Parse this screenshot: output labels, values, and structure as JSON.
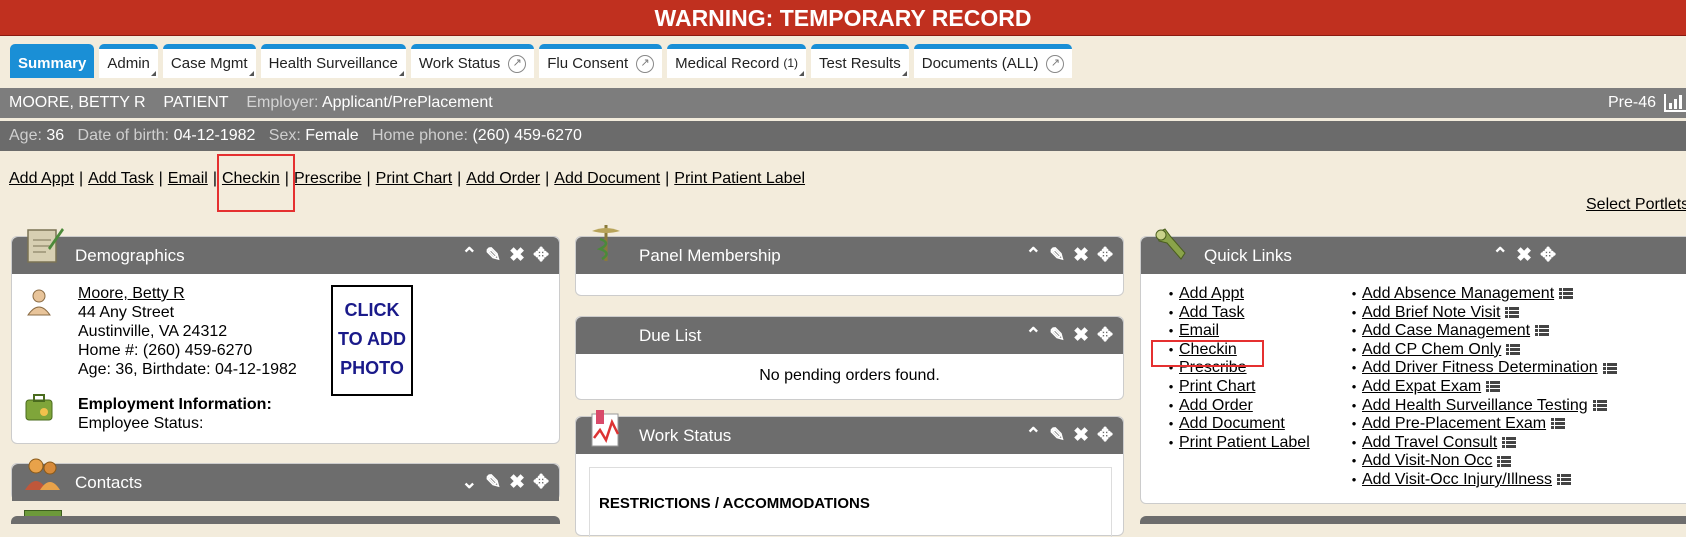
{
  "warning": "WARNING: TEMPORARY RECORD",
  "tabs": [
    {
      "label": "Summary",
      "icon": ""
    },
    {
      "label": "Admin",
      "icon": "corner"
    },
    {
      "label": "Case Mgmt",
      "icon": "corner"
    },
    {
      "label": "Health Surveillance",
      "icon": "corner"
    },
    {
      "label": "Work Status",
      "icon": "external-link-icon"
    },
    {
      "label": "Flu Consent",
      "icon": "external-link-icon"
    },
    {
      "label": "Medical Record",
      "count": "(1)",
      "icon": "corner"
    },
    {
      "label": "Test Results",
      "icon": "corner"
    },
    {
      "label": "Documents (ALL)",
      "icon": "external-link-icon"
    }
  ],
  "patient": {
    "name": "MOORE, BETTY R",
    "role": "PATIENT",
    "employer_label": "Employer:",
    "employer": "Applicant/PrePlacement",
    "code": "Pre-46",
    "age_label": "Age:",
    "age": "36",
    "dob_label": "Date of birth:",
    "dob": "04-12-1982",
    "sex_label": "Sex:",
    "sex": "Female",
    "phone_label": "Home phone:",
    "phone": "(260) 459-6270"
  },
  "actions": [
    "Add Appt",
    "Add Task",
    "Email",
    "Checkin",
    "Prescribe",
    "Print Chart",
    "Add Order",
    "Add Document",
    "Print Patient Label"
  ],
  "select_portlets": "Select Portlets",
  "demographics": {
    "title": "Demographics",
    "name_link": "Moore, Betty R",
    "street": "44 Any Street",
    "city": "Austinville, VA 24312",
    "home": "Home #: (260) 459-6270",
    "age_line": "Age: 36, Birthdate: 04-12-1982",
    "photo_l1": "CLICK",
    "photo_l2": "TO ADD",
    "photo_l3": "PHOTO",
    "employment_heading": "Employment Information:",
    "employee_status": "Employee Status:"
  },
  "contacts": {
    "title": "Contacts"
  },
  "panel_membership": {
    "title": "Panel Membership"
  },
  "due_list": {
    "title": "Due List",
    "empty": "No pending orders found."
  },
  "work_status": {
    "title": "Work Status",
    "heading": "RESTRICTIONS / ACCOMMODATIONS"
  },
  "quick_links": {
    "title": "Quick Links",
    "col1": [
      "Add Appt",
      "Add Task",
      "Email",
      "Checkin",
      "Prescribe",
      "Print Chart",
      "Add Order",
      "Add Document",
      "Print Patient Label"
    ],
    "col2": [
      "Add Absence Management",
      "Add Brief Note Visit",
      "Add Case Management",
      "Add CP Chem Only",
      "Add Driver Fitness Determination",
      "Add Expat Exam",
      "Add Health Surveillance Testing",
      "Add Pre-Placement Exam",
      "Add Travel Consult",
      "Add Visit-Non Occ",
      "Add Visit-Occ Injury/Illness"
    ]
  },
  "colors": {
    "warning": "#c0301f",
    "tab_accent": "#1a8fd6",
    "highlight": "#e53030"
  }
}
